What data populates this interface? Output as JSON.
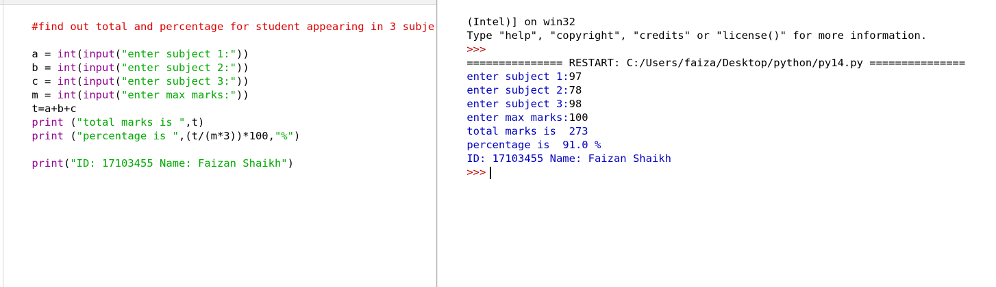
{
  "editor": {
    "comment": "#find out total and percentage for student appearing in 3 subje",
    "line_a": {
      "lhs": "a = ",
      "fn1": "int",
      "p1": "(",
      "fn2": "input",
      "p2": "(",
      "str": "\"enter subject 1:\"",
      "end": "))"
    },
    "line_b": {
      "lhs": "b = ",
      "fn1": "int",
      "p1": "(",
      "fn2": "input",
      "p2": "(",
      "str": "\"enter subject 2:\"",
      "end": "))"
    },
    "line_c": {
      "lhs": "c = ",
      "fn1": "int",
      "p1": "(",
      "fn2": "input",
      "p2": "(",
      "str": "\"enter subject 3:\"",
      "end": "))"
    },
    "line_m": {
      "lhs": "m = ",
      "fn1": "int",
      "p1": "(",
      "fn2": "input",
      "p2": "(",
      "str": "\"enter max marks:\"",
      "end": "))"
    },
    "line_t": "t=a+b+c",
    "line_print1": {
      "fn": "print",
      "p1": " (",
      "str": "\"total marks is \"",
      "end": ",t)"
    },
    "line_print2": {
      "fn": "print",
      "p1": " (",
      "str": "\"percentage is \"",
      "mid": ",(t/(m*3))*100,",
      "str2": "\"%\"",
      "end": ")"
    },
    "line_print3": {
      "fn": "print",
      "p1": "(",
      "str": "\"ID: 17103455 Name: Faizan Shaikh\"",
      "end": ")"
    }
  },
  "shell": {
    "header1": "(Intel)] on win32",
    "header2": "Type \"help\", \"copyright\", \"credits\" or \"license()\" for more information.",
    "prompt1": ">>>",
    "restart": "=============== RESTART: C:/Users/faiza/Desktop/python/py14.py ===============",
    "out1_label": "enter subject 1:",
    "out1_val": "97",
    "out2_label": "enter subject 2:",
    "out2_val": "78",
    "out3_label": "enter subject 3:",
    "out3_val": "98",
    "out4_label": "enter max marks:",
    "out4_val": "100",
    "out5": "total marks is  273",
    "out6": "percentage is  91.0 %",
    "out7": "ID: 17103455 Name: Faizan Shaikh",
    "prompt2": ">>>"
  }
}
